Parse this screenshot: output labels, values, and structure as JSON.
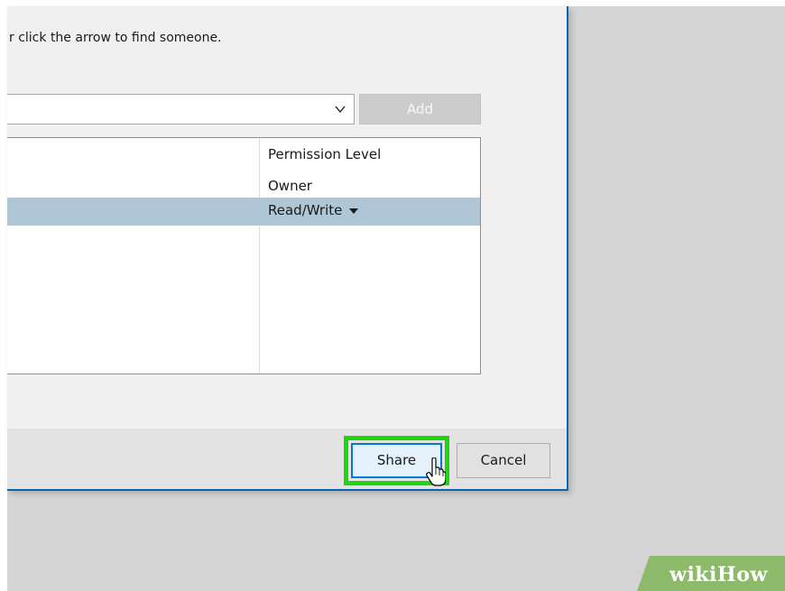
{
  "dialog": {
    "instruction_text": "r click the arrow to find someone.",
    "add_button_label": "Add",
    "permission_list": {
      "column_header": "Permission Level",
      "rows": [
        {
          "permission": "Owner",
          "selected": false
        },
        {
          "permission": "Read/Write",
          "selected": true
        }
      ]
    },
    "footer": {
      "share_label": "Share",
      "cancel_label": "Cancel"
    }
  },
  "watermark": {
    "text_wiki": "wiki",
    "text_how": "How"
  },
  "colors": {
    "highlight": "#1dd60e",
    "selection": "#aec6d6",
    "watermark_green": "#8db96a",
    "share_border": "#0078d7"
  },
  "icons": [
    "chevron-down-icon",
    "dropdown-triangle-icon",
    "mouse-cursor-icon"
  ]
}
